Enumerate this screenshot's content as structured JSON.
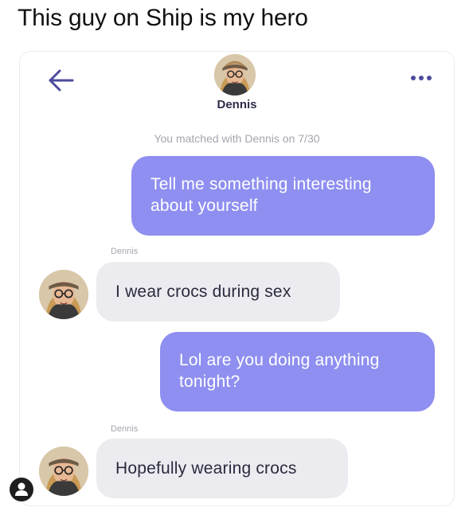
{
  "caption": "This guy on Ship is my hero",
  "header": {
    "name": "Dennis",
    "back_icon": "arrow-left-icon",
    "more_icon": "more-horizontal-icon"
  },
  "matched_text": "You matched with Dennis on 7/30",
  "messages": [
    {
      "from": "me",
      "text": "Tell me something interesting about yourself"
    },
    {
      "from": "Dennis",
      "sender_label": "Dennis",
      "text": "I wear crocs during sex"
    },
    {
      "from": "me",
      "text": "Lol are you doing anything tonight?"
    },
    {
      "from": "Dennis",
      "sender_label": "Dennis",
      "text": "Hopefully wearing crocs"
    }
  ],
  "colors": {
    "outgoing_bubble": "#8e8ff0",
    "incoming_bubble": "#ebebf0",
    "accent": "#4d4a9e"
  }
}
